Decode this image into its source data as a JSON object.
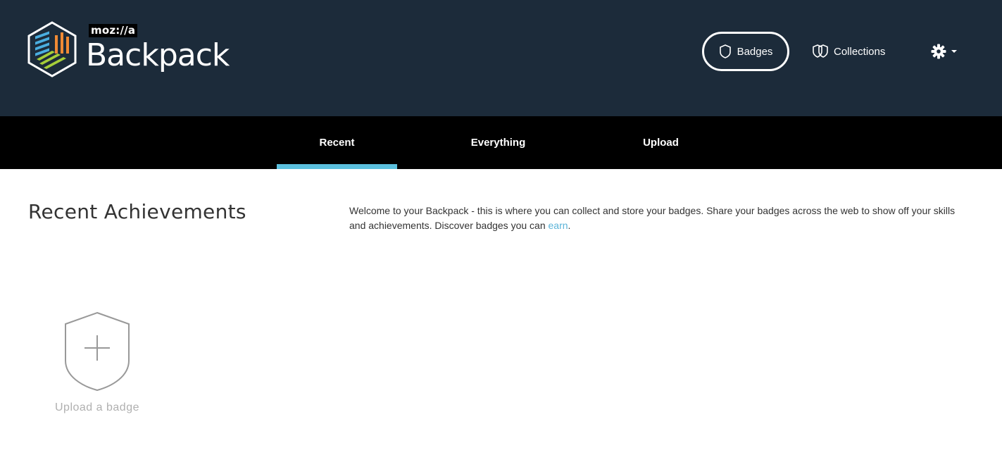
{
  "header": {
    "brand": "moz://a",
    "product": "Backpack",
    "nav": {
      "badges_label": "Badges",
      "collections_label": "Collections"
    },
    "settings_icon": "gear-icon",
    "dropdown_icon": "caret-down-icon"
  },
  "tabs": [
    {
      "label": "Recent",
      "active": true
    },
    {
      "label": "Everything",
      "active": false
    },
    {
      "label": "Upload",
      "active": false
    }
  ],
  "main": {
    "title": "Recent Achievements",
    "intro_text": "Welcome to your Backpack - this is where you can collect and store your badges. Share your badges across the web to show off your skills and achievements. Discover badges you can ",
    "intro_link": "earn",
    "intro_end": ".",
    "upload_tile_label": "Upload a badge"
  },
  "colors": {
    "header_bg": "#1c2b3a",
    "tabbar_bg": "#000000",
    "active_tab_underline": "#5bc0de",
    "link": "#5bb4d8"
  }
}
